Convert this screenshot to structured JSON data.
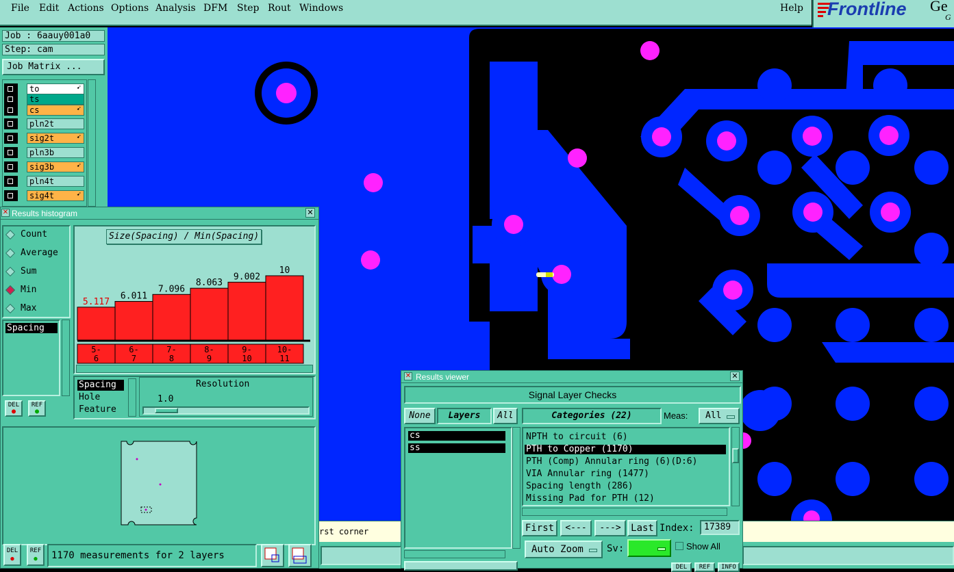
{
  "menu": {
    "items": [
      "File",
      "Edit",
      "Actions",
      "Options",
      "Analysis",
      "DFM",
      "Step",
      "Rout",
      "Windows"
    ],
    "help": "Help"
  },
  "logo": {
    "text": "Frontline",
    "extra": "Ge",
    "sub": "G"
  },
  "job": {
    "label": "Job : 6aauy001a0",
    "step": "Step: cam",
    "matrix_button": "Job Matrix ..."
  },
  "layers": [
    {
      "name": "to",
      "color": "#ffffff",
      "arrow": true
    },
    {
      "name": "ts",
      "color": "#00a88a",
      "arrow": false
    },
    {
      "name": "cs",
      "color": "#ffb347",
      "arrow": true
    },
    {
      "name": "pln2t",
      "color": "#9ddfd0",
      "arrow": false
    },
    {
      "name": "sig2t",
      "color": "#ffb347",
      "arrow": true
    },
    {
      "name": "pln3b",
      "color": "#9ddfd0",
      "arrow": false
    },
    {
      "name": "sig3b",
      "color": "#ffb347",
      "arrow": true
    },
    {
      "name": "pln4t",
      "color": "#9ddfd0",
      "arrow": false
    },
    {
      "name": "sig4t",
      "color": "#ffb347",
      "arrow": true
    }
  ],
  "histogram": {
    "title": "Results histogram",
    "modes": [
      "Count",
      "Average",
      "Sum",
      "Min",
      "Max"
    ],
    "selected_mode": "Min",
    "list": [
      "Spacing"
    ],
    "del": "DEL",
    "ref": "REF",
    "chart_title": "Size(Spacing) / Min(Spacing)",
    "types": [
      "Spacing",
      "Hole",
      "Feature"
    ],
    "resolution_label": "Resolution",
    "resolution_value": "1.0",
    "status": "1170 measurements for 2 layers"
  },
  "chart_data": {
    "type": "bar",
    "title": "Size(Spacing) / Min(Spacing)",
    "categories": [
      "5-6",
      "6-7",
      "7-8",
      "8-9",
      "9-10",
      "10-11"
    ],
    "category_labels": [
      [
        "5-",
        "6"
      ],
      [
        "6-",
        "7"
      ],
      [
        "7-",
        "8"
      ],
      [
        "8-",
        "9"
      ],
      [
        "9-",
        "10"
      ],
      [
        "10-",
        "11"
      ]
    ],
    "values": [
      5.117,
      6.011,
      7.096,
      8.063,
      9.002,
      10
    ],
    "value_labels": [
      "5.117",
      "6.011",
      "7.096",
      "8.063",
      "9.002",
      "10"
    ],
    "highlight_label_color": "#e00000",
    "bar_color": "#ff2020",
    "ylim": [
      0,
      10
    ]
  },
  "viewer": {
    "title": "Results viewer",
    "banner": "Signal Layer Checks",
    "none": "None",
    "layers_tab": "Layers",
    "all": "All",
    "layers": [
      "cs",
      "ss"
    ],
    "categories_label": "Categories (22)",
    "meas_label": "Meas:",
    "meas_value": "All",
    "categories": [
      "NPTH to circuit (6)",
      "PTH to Copper (1170)",
      "PTH (Comp) Annular ring (6)(D:6)",
      "VIA Annular ring (1477)",
      "Spacing length (286)",
      "Missing Pad for PTH (12)"
    ],
    "selected_category": 1,
    "first": "First",
    "prev": "<---",
    "next": "--->",
    "last": "Last",
    "index_label": "Index:",
    "index_value": "17389",
    "auto_zoom": "Auto Zoom",
    "sv_label": "Sv:",
    "show_all": "Show All",
    "bottom_del": "DEL",
    "bottom_ref": "REF",
    "bottom_info": "INFO"
  },
  "statusline": {
    "text": "rst corner"
  },
  "colors": {
    "board": "#0026ff",
    "pad": "#ff22ff",
    "panel": "#52c8a6",
    "field": "#9ddfd0"
  }
}
